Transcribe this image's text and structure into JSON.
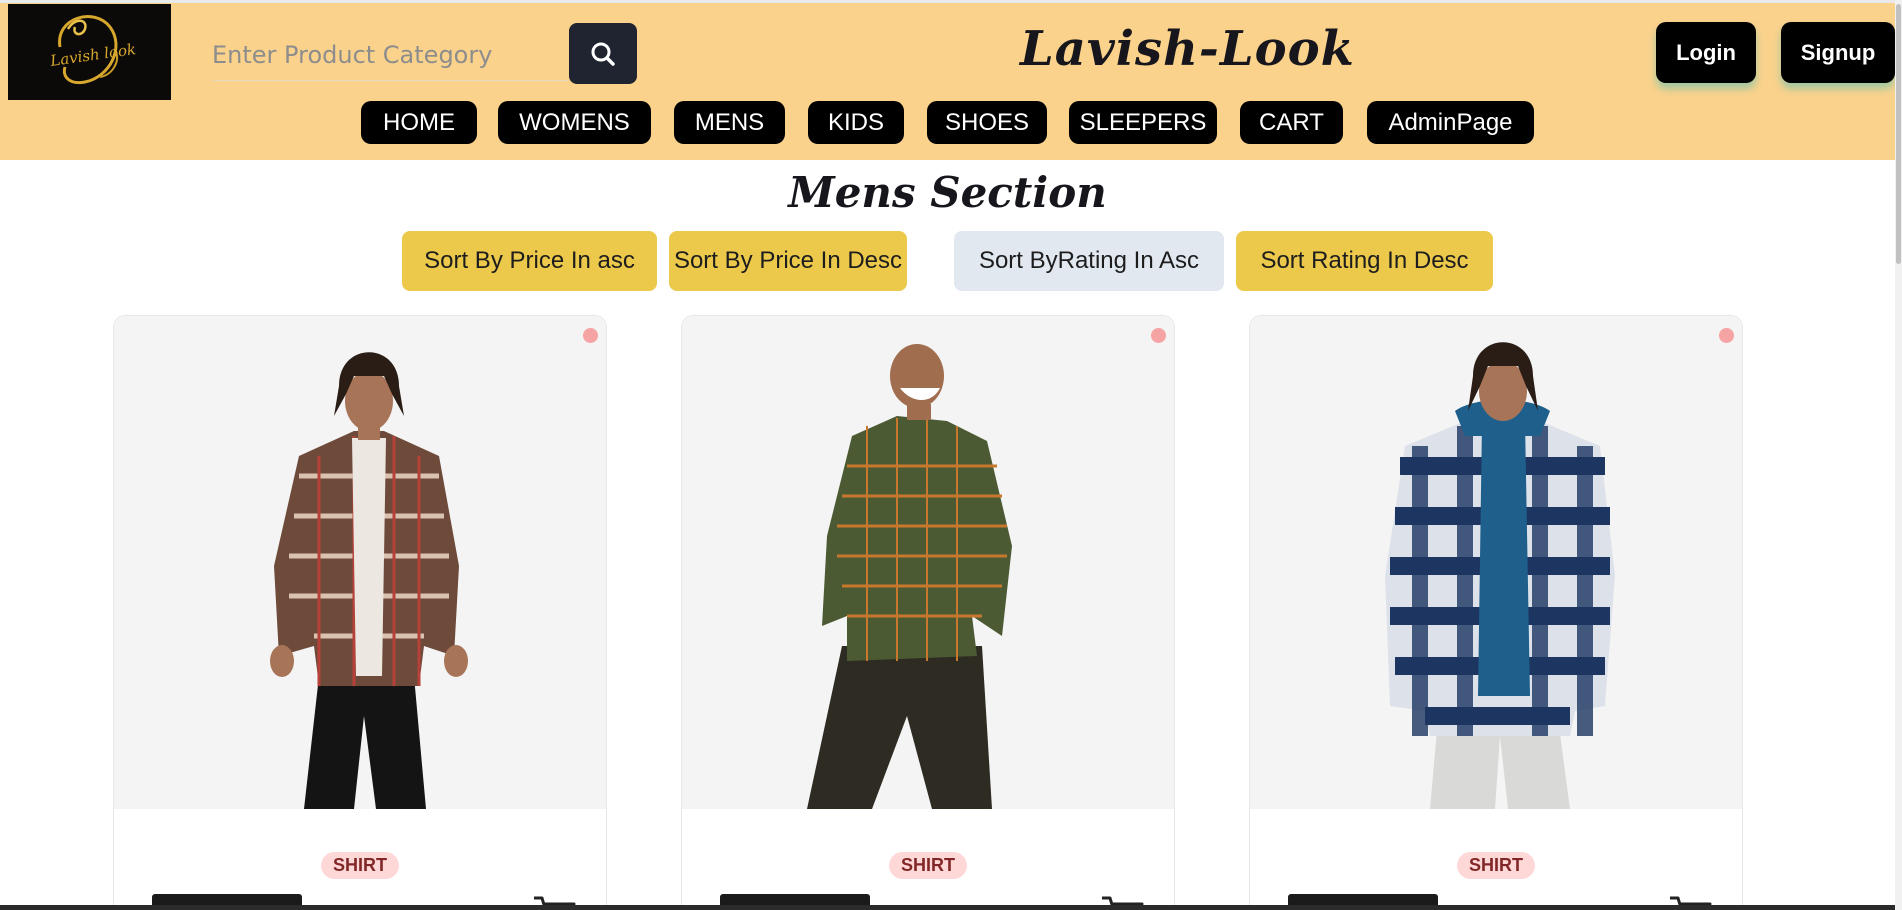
{
  "app": {
    "brand": "Lavish-Look",
    "logo_text": "Lavish look"
  },
  "search": {
    "placeholder": "Enter Product Category",
    "icon": "search-icon"
  },
  "auth": {
    "login": "Login",
    "signup": "Signup"
  },
  "nav": [
    "HOME",
    "WOMENS",
    "MENS",
    "KIDS",
    "SHOES",
    "SLEEPERS",
    "CART",
    "AdminPage"
  ],
  "section": {
    "title": "Mens Section"
  },
  "sort": [
    {
      "label": "Sort By Price In asc",
      "active": false
    },
    {
      "label": "Sort By Price In Desc",
      "active": false
    },
    {
      "label": "Sort ByRating In Asc",
      "active": true
    },
    {
      "label": "Sort Rating In Desc",
      "active": false
    }
  ],
  "products": [
    {
      "badge": "SHIRT",
      "image": "model in brown-white plaid flannel shirt",
      "cart_icon": "cart-icon"
    },
    {
      "badge": "SHIRT",
      "image": "laughing model in green-orange checked shirt",
      "cart_icon": "cart-icon"
    },
    {
      "badge": "SHIRT",
      "image": "model in navy-white buffalo check shirt jacket with blue hoodie",
      "cart_icon": "cart-icon"
    }
  ],
  "colors": {
    "header_bg": "#fad28c",
    "sort_gold": "#ecc94b",
    "sort_active": "#e2e8f0",
    "badge_bg": "#fed7d7",
    "badge_text": "#822727"
  }
}
